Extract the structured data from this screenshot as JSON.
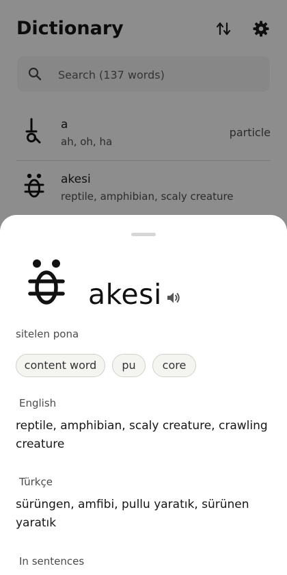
{
  "app": {
    "title": "Dictionary",
    "sort_icon": "sort-arrows-icon",
    "settings_icon": "gear-icon"
  },
  "search": {
    "placeholder": "Search (137 words)",
    "icon": "search-icon"
  },
  "word_list": [
    {
      "word": "a",
      "definition": "ah, oh, ha",
      "part_of_speech": "particle"
    },
    {
      "word": "akesi",
      "definition": "reptile, amphibian, scaly creature",
      "part_of_speech": ""
    }
  ],
  "detail": {
    "word": "akesi",
    "speaker_icon": "speaker-icon",
    "glyph_label": "sitelen pona",
    "tags": [
      "content word",
      "pu",
      "core"
    ],
    "sections": [
      {
        "label": "English",
        "text": "reptile, amphibian, scaly creature, crawling creature"
      },
      {
        "label": "Türkçe",
        "text": "sürüngen, amfibi, pullu yaratık, sürünen yaratık"
      },
      {
        "label": "In sentences",
        "text": ""
      }
    ]
  },
  "colors": {
    "sheet_background": "#ffffff",
    "chip_background": "#f4f5f0",
    "chip_border": "#cfd2c8",
    "text_primary": "#151515",
    "text_secondary": "#4a4a4a"
  }
}
